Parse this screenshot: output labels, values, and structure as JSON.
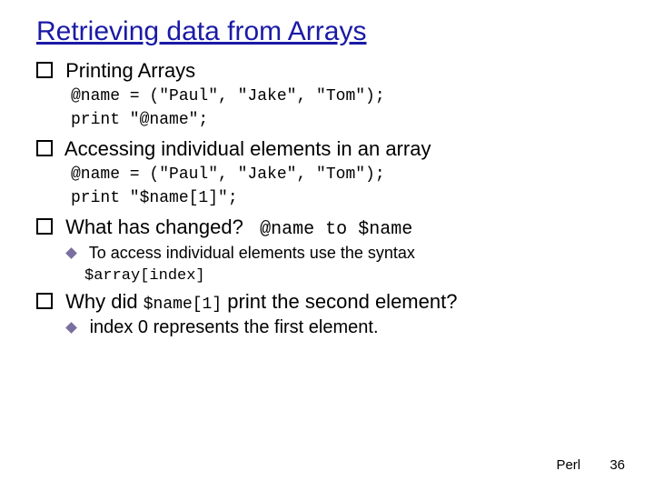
{
  "title": "Retrieving data from Arrays",
  "sections": {
    "printing": {
      "heading": "Printing Arrays",
      "code1": "@name = (\"Paul\", \"Jake\", \"Tom\");",
      "code2": "print \"@name\";"
    },
    "accessing": {
      "heading": "Accessing individual elements in an array",
      "code1": "@name = (\"Paul\", \"Jake\", \"Tom\");",
      "code2": "print \"$name[1]\";"
    },
    "changed": {
      "heading": "What has changed?",
      "note_code": "@name to $name",
      "sub_pre": "To access individual elements use the syntax",
      "sub_code": "$array[index]"
    },
    "why": {
      "heading_pre": "Why did",
      "heading_code": "$name[1]",
      "heading_post": "print the second element?",
      "sub": "index 0 represents the first element."
    }
  },
  "footer": {
    "label": "Perl",
    "page": "36"
  }
}
